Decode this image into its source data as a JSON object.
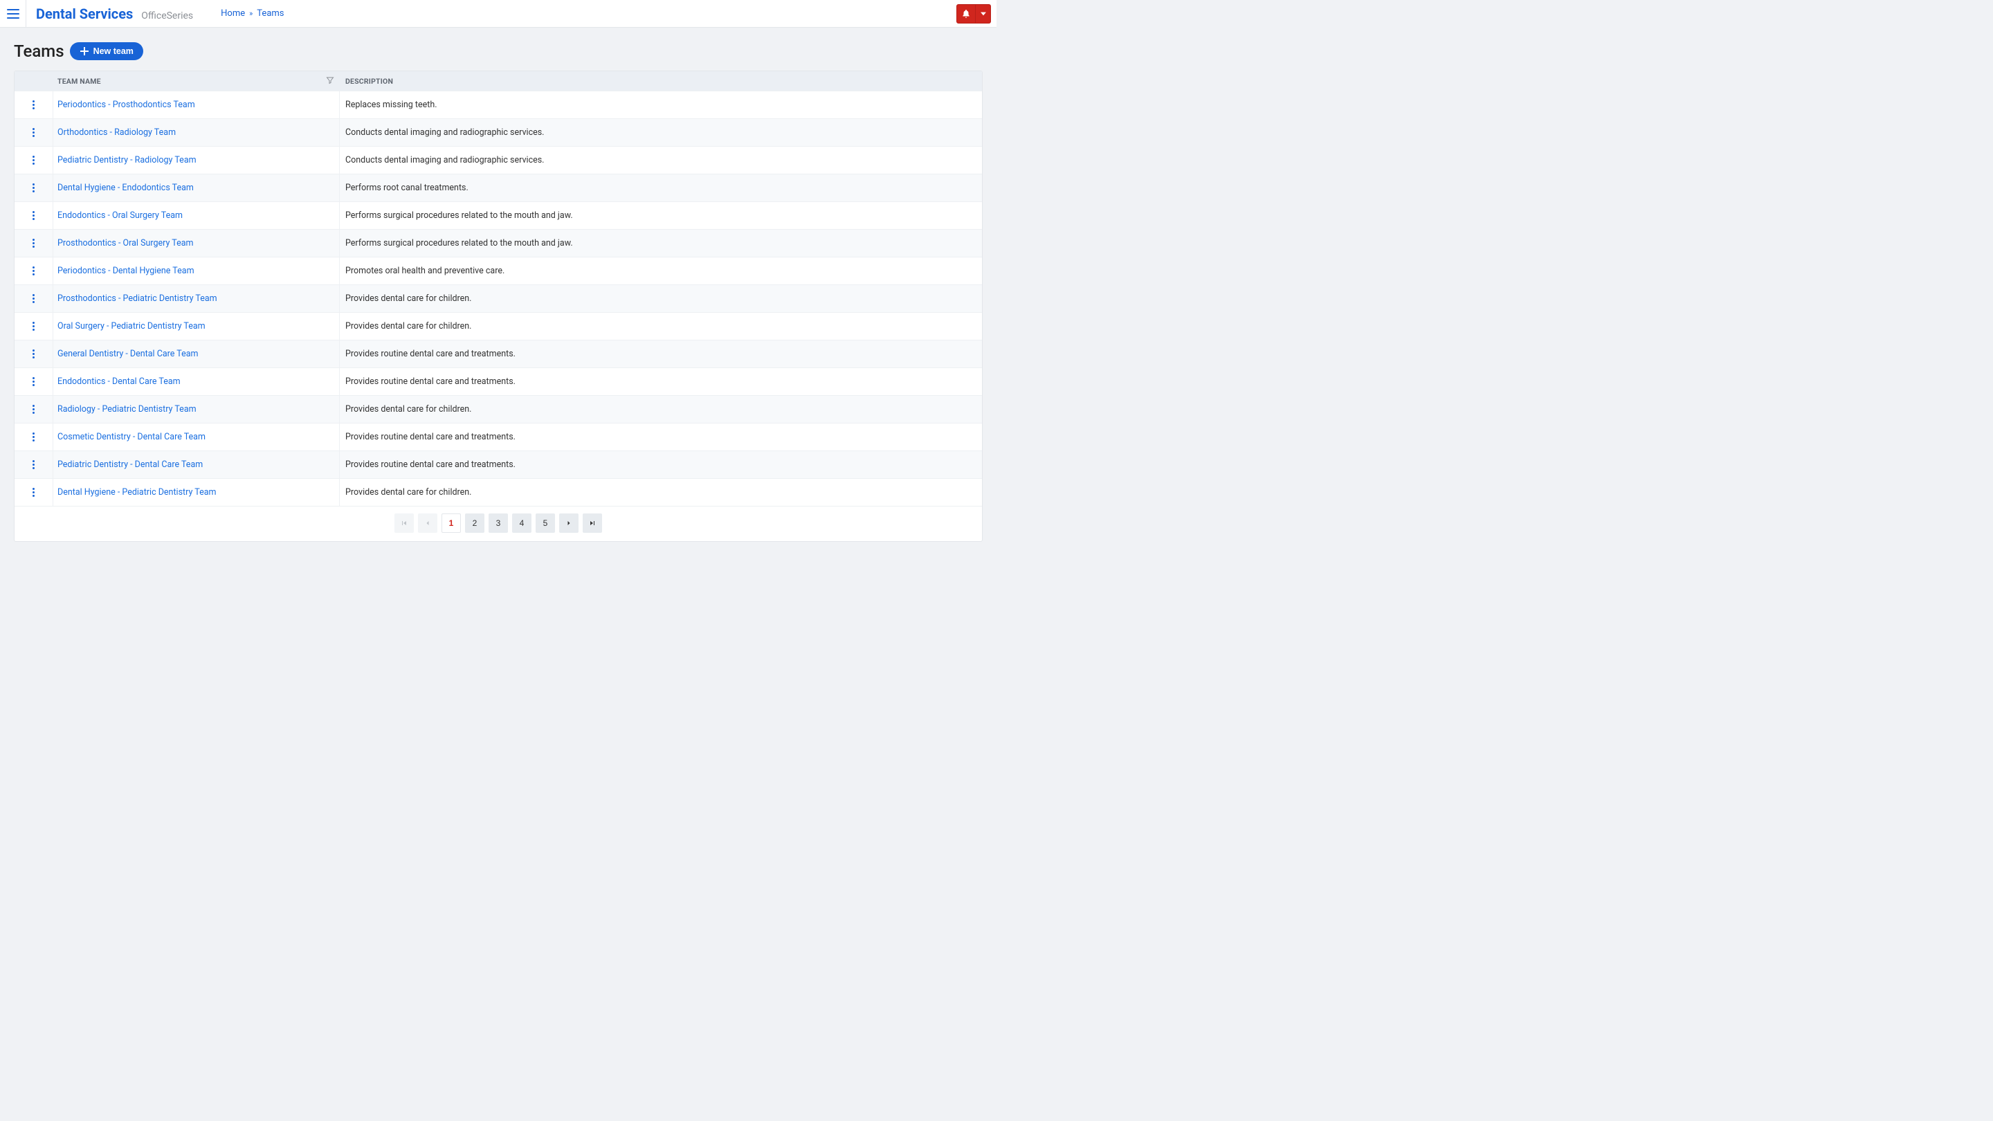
{
  "header": {
    "brand_title": "Dental Services",
    "brand_sub": "OfficeSeries"
  },
  "breadcrumbs": {
    "home": "Home",
    "sep": "»",
    "current": "Teams"
  },
  "page": {
    "title": "Teams",
    "new_button": "New team"
  },
  "table": {
    "columns": {
      "name": "TEAM NAME",
      "description": "DESCRIPTION"
    },
    "rows": [
      {
        "name": "Periodontics - Prosthodontics Team",
        "description": "Replaces missing teeth."
      },
      {
        "name": "Orthodontics - Radiology Team",
        "description": "Conducts dental imaging and radiographic services."
      },
      {
        "name": "Pediatric Dentistry - Radiology Team",
        "description": "Conducts dental imaging and radiographic services."
      },
      {
        "name": "Dental Hygiene - Endodontics Team",
        "description": "Performs root canal treatments."
      },
      {
        "name": "Endodontics - Oral Surgery Team",
        "description": "Performs surgical procedures related to the mouth and jaw."
      },
      {
        "name": "Prosthodontics - Oral Surgery Team",
        "description": "Performs surgical procedures related to the mouth and jaw."
      },
      {
        "name": "Periodontics - Dental Hygiene Team",
        "description": "Promotes oral health and preventive care."
      },
      {
        "name": "Prosthodontics - Pediatric Dentistry Team",
        "description": "Provides dental care for children."
      },
      {
        "name": "Oral Surgery - Pediatric Dentistry Team",
        "description": "Provides dental care for children."
      },
      {
        "name": "General Dentistry - Dental Care Team",
        "description": "Provides routine dental care and treatments."
      },
      {
        "name": "Endodontics - Dental Care Team",
        "description": "Provides routine dental care and treatments."
      },
      {
        "name": "Radiology - Pediatric Dentistry Team",
        "description": "Provides dental care for children."
      },
      {
        "name": "Cosmetic Dentistry - Dental Care Team",
        "description": "Provides routine dental care and treatments."
      },
      {
        "name": "Pediatric Dentistry - Dental Care Team",
        "description": "Provides routine dental care and treatments."
      },
      {
        "name": "Dental Hygiene - Pediatric Dentistry Team",
        "description": "Provides dental care for children."
      }
    ]
  },
  "pagination": {
    "pages": [
      "1",
      "2",
      "3",
      "4",
      "5"
    ],
    "current": "1"
  }
}
